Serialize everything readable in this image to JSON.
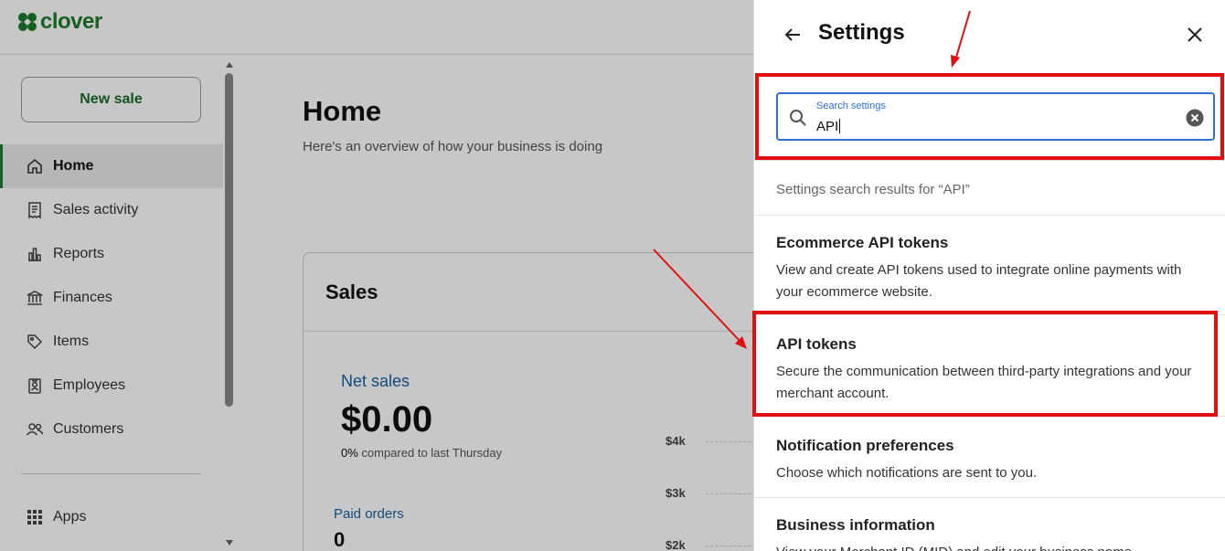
{
  "brand": {
    "name": "clover",
    "color": "#1c7a2e"
  },
  "sidebar": {
    "new_sale_label": "New sale",
    "items": [
      {
        "label": "Home",
        "icon": "home-icon",
        "active": true
      },
      {
        "label": "Sales activity",
        "icon": "receipt-icon"
      },
      {
        "label": "Reports",
        "icon": "bar-chart-icon"
      },
      {
        "label": "Finances",
        "icon": "bank-icon"
      },
      {
        "label": "Items",
        "icon": "tag-icon"
      },
      {
        "label": "Employees",
        "icon": "badge-icon"
      },
      {
        "label": "Customers",
        "icon": "people-icon"
      }
    ],
    "apps_label": "Apps"
  },
  "main": {
    "title": "Home",
    "subtitle": "Here's an overview of how your business is doing",
    "sales_card": {
      "title": "Sales",
      "net_sales_label": "Net sales",
      "net_sales_value": "$0.00",
      "compare_pct": "0%",
      "compare_text": " compared to last Thursday",
      "paid_orders_label": "Paid orders",
      "paid_orders_value": "0",
      "axis_ticks": [
        "$4k",
        "$3k",
        "$2k"
      ]
    }
  },
  "settings_panel": {
    "title": "Settings",
    "search": {
      "placeholder": "Search settings",
      "value": "API"
    },
    "results_label": "Settings search results for “API”",
    "results": [
      {
        "title": "Ecommerce API tokens",
        "description": "View and create API tokens used to integrate online payments with your ecommerce website."
      },
      {
        "title": "API tokens",
        "description": "Secure the communication between third-party integrations and your merchant account."
      },
      {
        "title": "Notification preferences",
        "description": "Choose which notifications are sent to you."
      },
      {
        "title": "Business information",
        "description": "View your Merchant ID (MID) and edit your business name"
      }
    ]
  },
  "annotation_color": "#e01010"
}
